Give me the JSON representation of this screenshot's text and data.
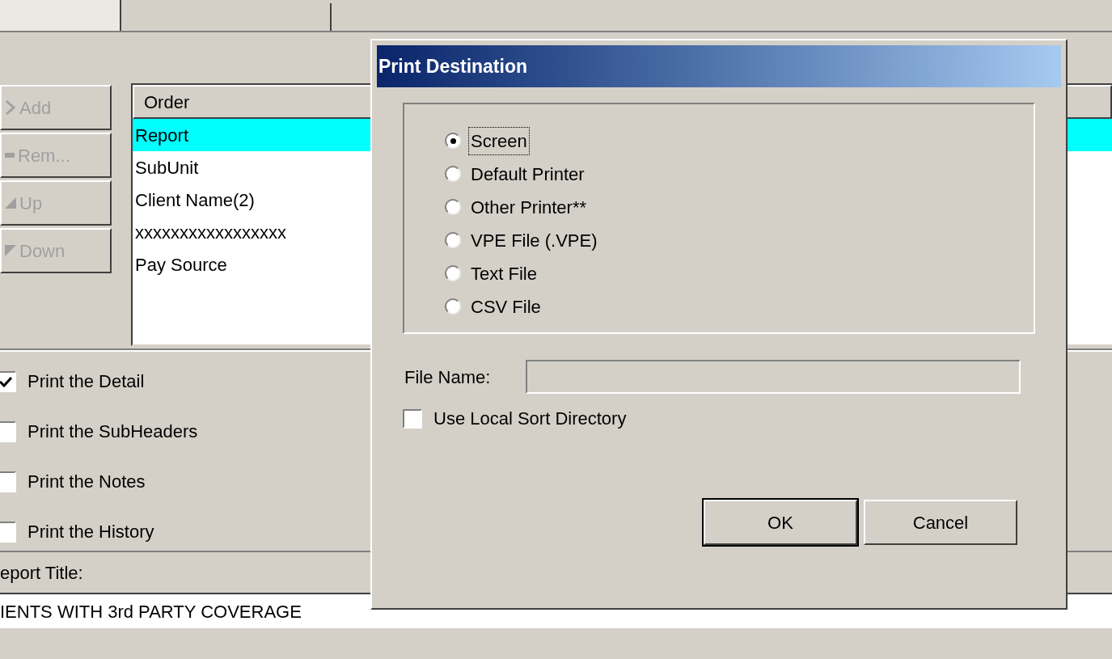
{
  "side_buttons": [
    {
      "label": "Add",
      "disabled": true
    },
    {
      "label": "Rem...",
      "disabled": true
    },
    {
      "label": "Up",
      "disabled": true
    },
    {
      "label": "Down",
      "disabled": true
    }
  ],
  "order_list": {
    "header": "Order",
    "rows": [
      {
        "text": "Report",
        "selected": true
      },
      {
        "text": "SubUnit",
        "selected": false
      },
      {
        "text": "Client Name(2)",
        "selected": false
      },
      {
        "text": "xxxxxxxxxxxxxxxxx",
        "selected": false
      },
      {
        "text": "Pay Source",
        "selected": false
      }
    ]
  },
  "options": [
    {
      "label": "Print the Detail",
      "checked": true
    },
    {
      "label": "Print the SubHeaders",
      "checked": false
    },
    {
      "label": "Print the Notes",
      "checked": false
    },
    {
      "label": "Print the History",
      "checked": false
    }
  ],
  "report_title": {
    "label": "eport Title:",
    "value": "IENTS WITH 3rd PARTY COVERAGE"
  },
  "dialog": {
    "title": "Print Destination",
    "destinations": [
      {
        "label": "Screen",
        "selected": true,
        "focused": true
      },
      {
        "label": "Default Printer",
        "selected": false,
        "focused": false
      },
      {
        "label": "Other Printer**",
        "selected": false,
        "focused": false
      },
      {
        "label": "VPE File (.VPE)",
        "selected": false,
        "focused": false
      },
      {
        "label": "Text File",
        "selected": false,
        "focused": false
      },
      {
        "label": "CSV File",
        "selected": false,
        "focused": false
      }
    ],
    "file_name": {
      "label": "File Name:",
      "disabled": true
    },
    "use_local_sort": {
      "label": "Use Local Sort Directory",
      "checked": false
    },
    "buttons": [
      {
        "label": "OK",
        "default": true
      },
      {
        "label": "Cancel",
        "default": false
      }
    ]
  }
}
